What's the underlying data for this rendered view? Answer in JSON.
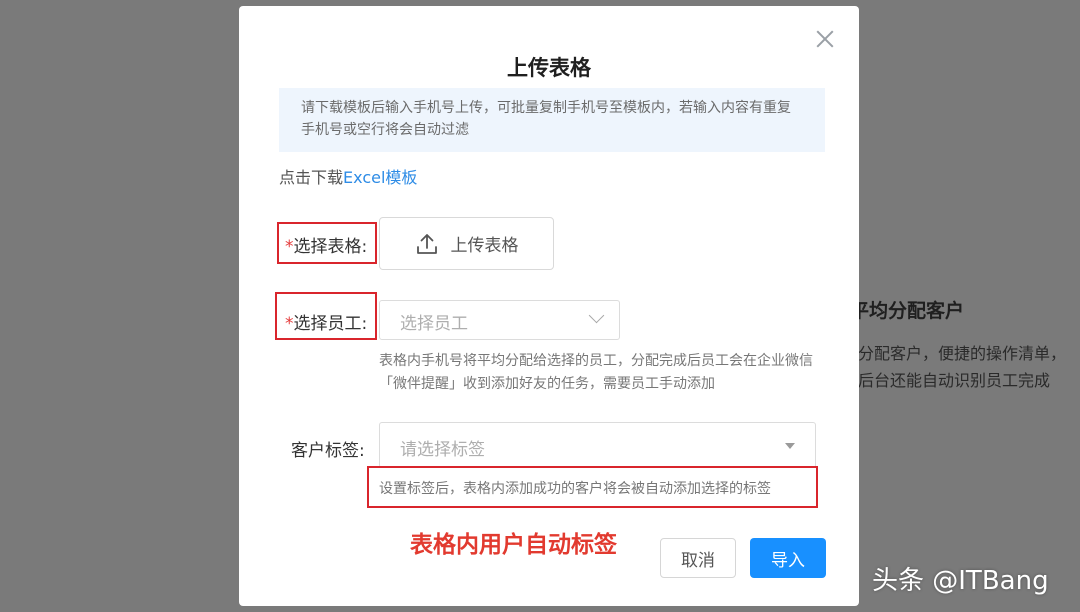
{
  "background": {
    "heading": "平均分配客户",
    "line1": "分配客户，便捷的操作清单，",
    "line2": "后台还能自动识别员工完成"
  },
  "modal": {
    "title": "上传表格",
    "close_icon": "close-icon",
    "info_text": "请下载模板后输入手机号上传，可批量复制手机号至模板内，若输入内容有重复手机号或空行将会自动过滤",
    "download_prefix": "点击下载",
    "download_link": "Excel模板",
    "form": {
      "table_required_mark": "*",
      "table_label": "选择表格:",
      "upload_button": "上传表格",
      "upload_icon": "upload-icon",
      "employee_required_mark": "*",
      "employee_label": "选择员工:",
      "employee_placeholder": "选择员工",
      "employee_hint": "表格内手机号将平均分配给选择的员工，分配完成后员工会在企业微信「微伴提醒」收到添加好友的任务，需要员工手动添加",
      "tag_label": "客户标签:",
      "tag_placeholder": "请选择标签",
      "tag_hint": "设置标签后，表格内添加成功的客户将会被自动添加选择的标签"
    },
    "cancel_button": "取消",
    "import_button": "导入"
  },
  "annotation": "表格内用户自动标签",
  "watermark": "头条 @ITBang",
  "colors": {
    "accent": "#1890ff",
    "link": "#2e8ce6",
    "highlight_box": "#d9252c",
    "annotation": "#e23a2f",
    "overlay": "#7a7a7a"
  }
}
